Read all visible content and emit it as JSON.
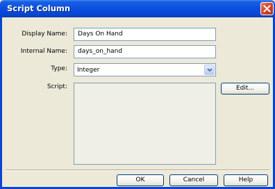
{
  "window": {
    "title": "Script Column"
  },
  "fields": {
    "display_name": {
      "label": "Display Name:",
      "value": "Days On Hand"
    },
    "internal_name": {
      "label": "Internal Name:",
      "value": "days_on_hand"
    },
    "type": {
      "label": "Type:",
      "value": "Integer"
    },
    "script": {
      "label": "Script:",
      "value": ""
    }
  },
  "buttons": {
    "edit": "Edit...",
    "ok": "OK",
    "cancel": "Cancel",
    "help": "Help"
  },
  "icons": {
    "close": "close-icon",
    "dropdown": "chevron-down-icon"
  },
  "colors": {
    "titlebar": "#0845d2",
    "close": "#d8442a",
    "background": "#ece9d8"
  }
}
